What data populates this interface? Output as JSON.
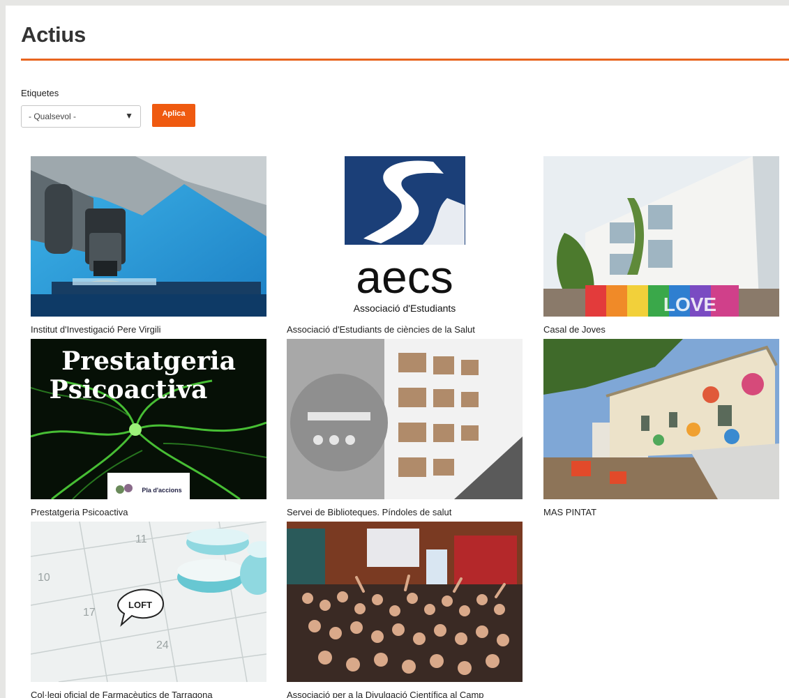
{
  "header": {
    "title": "Actius"
  },
  "filter": {
    "label": "Etiquetes",
    "select_value": "- Qualsevol -",
    "select_arrow": "▼",
    "apply_label": "Aplica"
  },
  "items": [
    {
      "caption": "Institut d'Investigació Pere Virgili"
    },
    {
      "caption": "Associació d'Estudiants de ciències de la Salut",
      "logo_text": "aecs",
      "logo_sub": "Associació d'Estudiants"
    },
    {
      "caption": "Casal de Joves",
      "mural_text": "LOVE"
    },
    {
      "caption": "Prestatgeria Psicoactiva",
      "image_line1": "Prestatgeria",
      "image_line2": "Psicoactiva",
      "badge": "Pla d'accions"
    },
    {
      "caption": "Servei de Biblioteques. Píndoles de salut"
    },
    {
      "caption": "MAS PINTAT"
    },
    {
      "caption": "Col·legi oficial de Farmacèutics de Tarragona",
      "bubble_text": "LOFT",
      "calendar_numbers": [
        "11",
        "10",
        "17",
        "24"
      ]
    },
    {
      "caption": "Associació per a la Divulgació Científica al Camp"
    }
  ],
  "colors": {
    "accent": "#e8651f",
    "button": "#ef5a10"
  }
}
